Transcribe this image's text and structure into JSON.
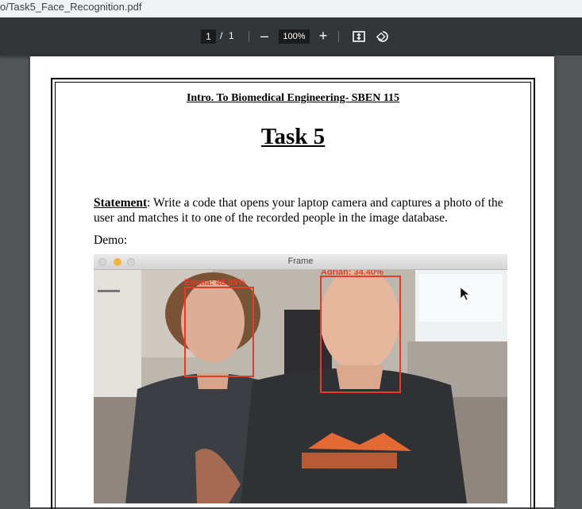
{
  "browser": {
    "url_text": "o/Task5_Face_Recognition.pdf"
  },
  "toolbar": {
    "current_page": "1",
    "page_separator": "/",
    "total_pages": "1",
    "zoom_out_label": "–",
    "zoom_level": "100%",
    "zoom_in_label": "+",
    "fit_icon": "fit-page-icon",
    "rotate_icon": "rotate-icon"
  },
  "document": {
    "course_title": "Intro. To Biomedical Engineering- SBEN 115",
    "task_title": "Task 5",
    "statement_label": "Statement",
    "statement_text": ": Write a code that opens your laptop camera and captures a photo of the user and matches it to one of the recorded people in the image database.",
    "demo_label": "Demo:"
  },
  "demo_window": {
    "title": "Frame",
    "faces": [
      {
        "label": "Emma: 48.85%"
      },
      {
        "label": "Adrian: 34.40%"
      }
    ]
  },
  "colors": {
    "toolbar_bg": "#323639",
    "viewer_bg": "#525659",
    "detection_box": "#e53c2a"
  }
}
